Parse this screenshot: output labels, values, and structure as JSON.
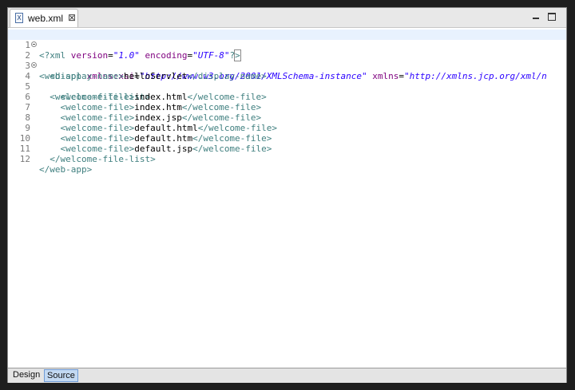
{
  "tab": {
    "icon": "xml-file-icon",
    "icon_glyph": "X",
    "title": "web.xml",
    "close_glyph": "⊠"
  },
  "editor": {
    "lines": [
      {
        "num": "1",
        "fold": false
      },
      {
        "num": "2",
        "fold": true
      },
      {
        "num": "3",
        "fold": false
      },
      {
        "num": "4",
        "fold": true
      },
      {
        "num": "5",
        "fold": false
      },
      {
        "num": "6",
        "fold": false
      },
      {
        "num": "7",
        "fold": false
      },
      {
        "num": "8",
        "fold": false
      },
      {
        "num": "9",
        "fold": false
      },
      {
        "num": "10",
        "fold": false
      },
      {
        "num": "11",
        "fold": false
      },
      {
        "num": "12",
        "fold": false
      }
    ],
    "code": {
      "l1": {
        "open": "<?xml",
        "a1": "version",
        "eq1": "=",
        "v1": "\"1.0\"",
        "a2": "encoding",
        "eq2": "=",
        "v2": "\"UTF-8\"",
        "close_q": "?",
        "close_b": ">"
      },
      "l2": {
        "open": "<web-app",
        "a1": "xmlns:xsi",
        "eq1": "=",
        "v1": "\"http://www.w3.org/2001/XMLSchema-instance\"",
        "a2": "xmlns",
        "eq2": "=",
        "v2": "\"http://xmlns.jcp.org/xml/n"
      },
      "l3": {
        "open": "<display-name>",
        "text": "helloServlet",
        "close": "</display-name>"
      },
      "l4": {
        "open": "<welcome-file-list>"
      },
      "l5": {
        "open": "<welcome-file>",
        "text": "index.html",
        "close": "</welcome-file>"
      },
      "l6": {
        "open": "<welcome-file>",
        "text": "index.htm",
        "close": "</welcome-file>"
      },
      "l7": {
        "open": "<welcome-file>",
        "text": "index.jsp",
        "close": "</welcome-file>"
      },
      "l8": {
        "open": "<welcome-file>",
        "text": "default.html",
        "close": "</welcome-file>"
      },
      "l9": {
        "open": "<welcome-file>",
        "text": "default.htm",
        "close": "</welcome-file>"
      },
      "l10": {
        "open": "<welcome-file>",
        "text": "default.jsp",
        "close": "</welcome-file>"
      },
      "l11": {
        "open": "</welcome-file-list>"
      },
      "l12": {
        "open": "</web-app>"
      }
    }
  },
  "bottom_tabs": {
    "design": "Design",
    "source": "Source",
    "active": "Source"
  },
  "colors": {
    "tag": "#3f7f7f",
    "attribute": "#7f007f",
    "value": "#2a00ff",
    "current_line": "#e8f2fe",
    "active_tab": "#c3d9f2"
  }
}
